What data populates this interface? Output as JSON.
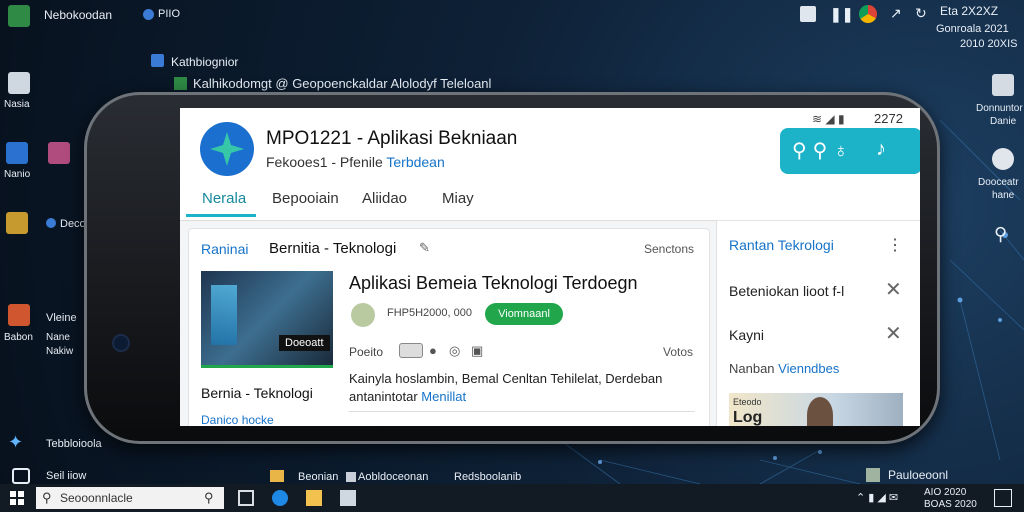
{
  "desktop": {
    "top_left_label": "Nebokoodan",
    "top_small_label": "PIIO",
    "window_title1": "Kathbiognior",
    "window_title2": "Kalhikodomgt @ Geopoenckaldar Alolodyf Teleloanl",
    "clock_top": "Eta 2X2XZ",
    "top_date1": "Gonroala 2021",
    "top_date2": "2010 20XIS",
    "left_icons": [
      "Nasia",
      "Nanio",
      "Deco",
      "Vleine",
      "Babon",
      "Nane",
      "Nakiw",
      "Tebbloioola",
      "Seil iiow"
    ],
    "right_icons": [
      "Donnuntor",
      "Danie",
      "Dooceatr",
      "hane"
    ],
    "bottom_labels": [
      "Beonian",
      "Aobldoceonan",
      "Redsboolanib"
    ],
    "bottom_right_label": "Pauloeoonl"
  },
  "phone": {
    "status_time": "2272",
    "app_title": "MPO1221 - Aplikasi Bekniaan",
    "app_subtitle_plain": "Fekooes1 - Pfenile",
    "app_subtitle_link": "Terbdean",
    "tabs": [
      "Nerala",
      "Bepooiain",
      "Aliidao",
      "Miay"
    ],
    "main_card": {
      "section_label": "Raninai",
      "section_title": "Bernitia - Teknologi",
      "section_action": "Senctons",
      "article_title": "Aplikasi Bemeia Teknologi Terdoegn",
      "meta_text": "FHP5H2000, 000",
      "badge": "Viomnaanl",
      "thumb_caption": "Doeoatt",
      "actions_label": "Poeito",
      "actions_right": "Votos",
      "description": "Kainyla hoslambin, Bemal Cenltan Tehilelat, Derdeban",
      "description2_plain": "antanintotar",
      "description2_link": "Menillat",
      "bottom_left_title": "Bernia - Teknologi",
      "bottom_left_sub": "Danico hocke"
    },
    "side_panel": {
      "title": "Rantan Tekrologi",
      "items": [
        "Beteniokan lioot f-l",
        "Kayni"
      ],
      "footer_plain": "Nanban",
      "footer_link": "Vienndbes",
      "thumb_label1": "Eteodo",
      "thumb_label2": "Log"
    }
  },
  "taskbar": {
    "search_placeholder": "Seooonnlacle",
    "tray_time": "AIO 2020",
    "tray_date": "BOAS 2020"
  },
  "colors": {
    "accent_teal": "#1cb3c8",
    "badge_green": "#21a64b",
    "link_blue": "#1673c9"
  }
}
